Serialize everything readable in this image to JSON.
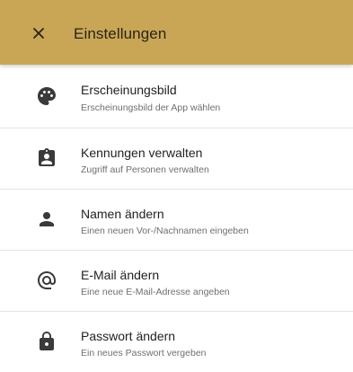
{
  "appbar": {
    "title": "Einstellungen",
    "close_icon": "close-icon",
    "background": "#c8a655"
  },
  "settings": {
    "items": [
      {
        "title": "Erscheinungsbild",
        "subtitle": "Erscheinungsbild der App wählen",
        "icon": "palette-icon"
      },
      {
        "title": "Kennungen verwalten",
        "subtitle": "Zugriff auf Personen verwalten",
        "icon": "clipboard-account-icon"
      },
      {
        "title": "Namen ändern",
        "subtitle": "Einen neuen Vor-/Nachnamen eingeben",
        "icon": "person-icon"
      },
      {
        "title": "E-Mail ändern",
        "subtitle": "Eine neue E-Mail-Adresse angeben",
        "icon": "at-sign-icon"
      },
      {
        "title": "Passwort ändern",
        "subtitle": "Ein neues Passwort vergeben",
        "icon": "lock-icon"
      }
    ]
  }
}
